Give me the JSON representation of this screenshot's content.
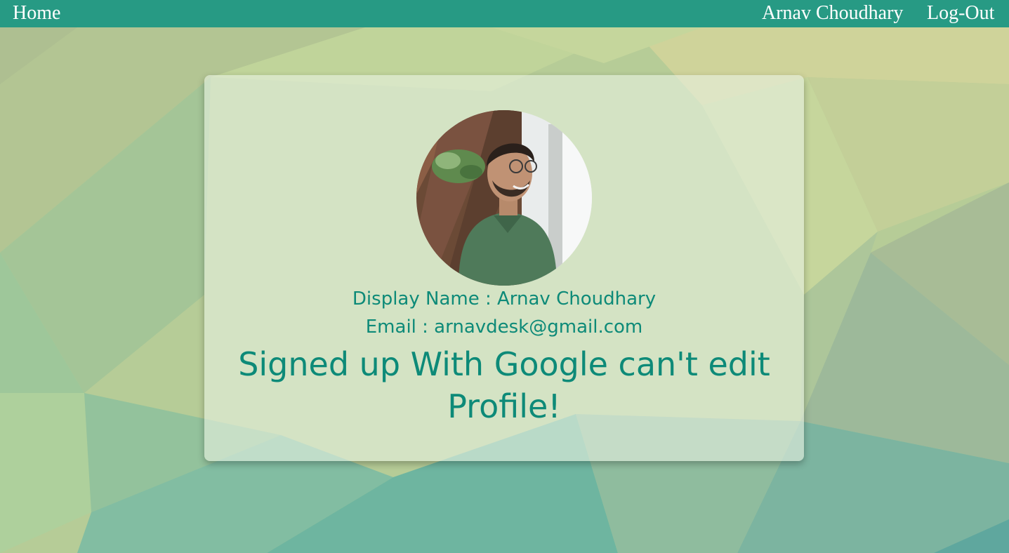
{
  "navbar": {
    "home_label": "Home",
    "user_name": "Arnav Choudhary",
    "logout_label": "Log-Out"
  },
  "profile": {
    "display_name_text": "Display Name : Arnav Choudhary",
    "email_text": "Email : arnavdesk@gmail.com",
    "notice_text": "Signed up With Google can't edit Profile!"
  },
  "colors": {
    "navbar": "#279a84",
    "accent_text": "#0d8a78"
  }
}
